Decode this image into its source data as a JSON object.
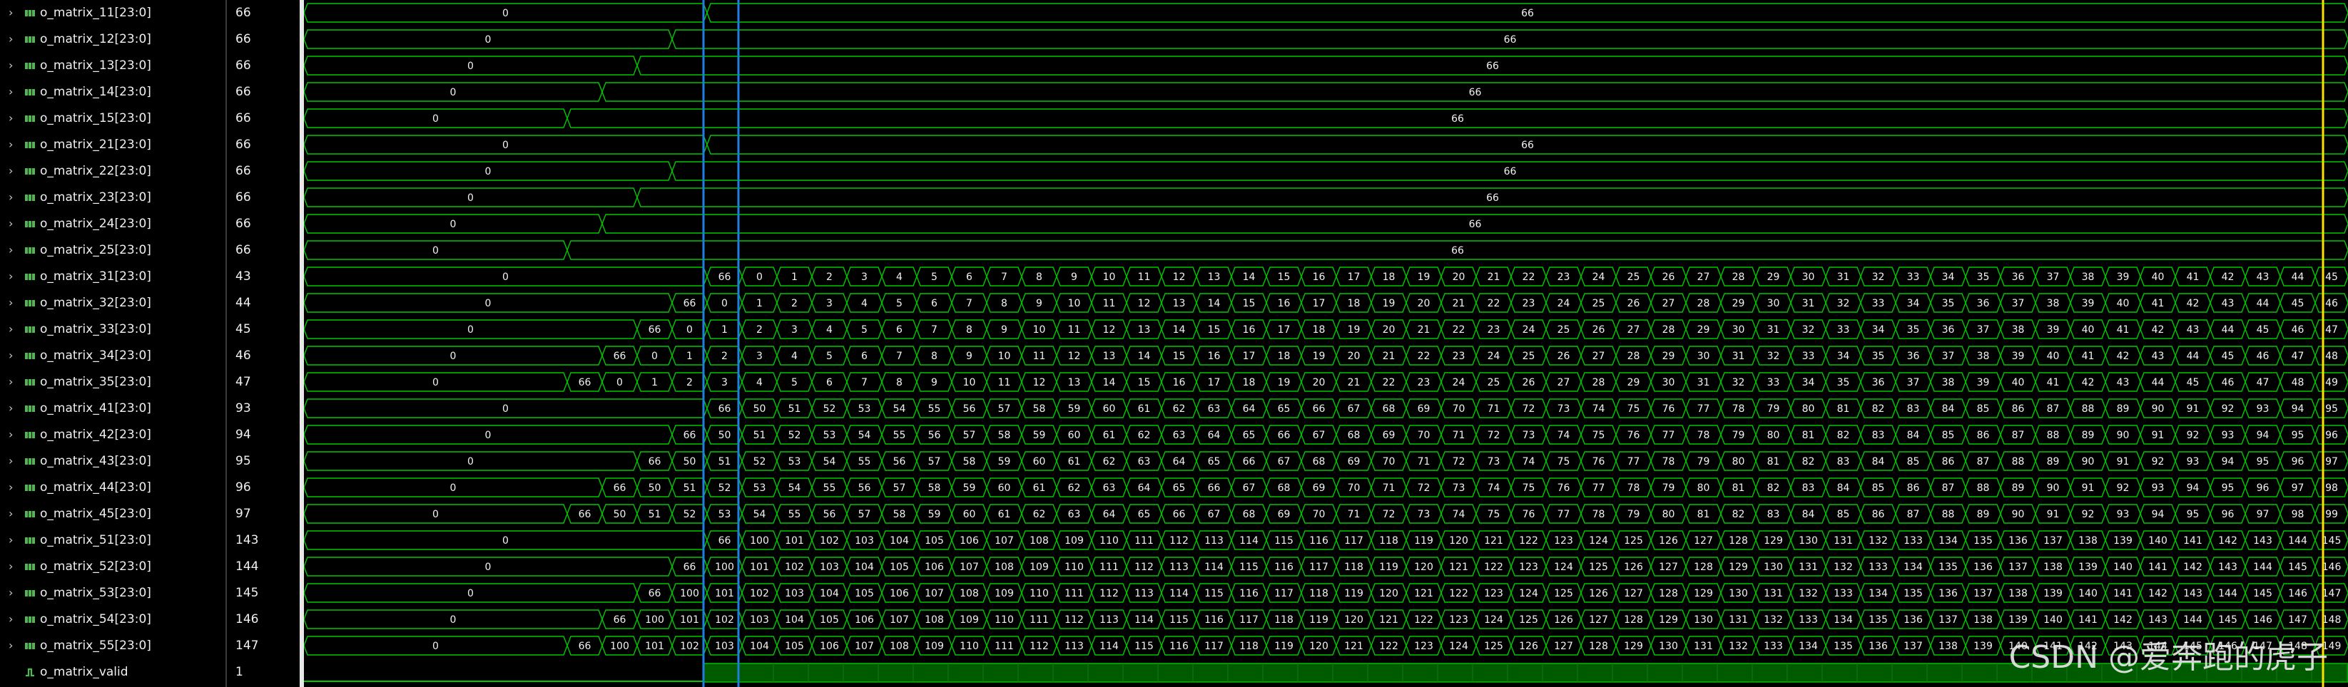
{
  "signals": [
    {
      "name": "o_matrix_11[23:0]",
      "value": "66"
    },
    {
      "name": "o_matrix_12[23:0]",
      "value": "66"
    },
    {
      "name": "o_matrix_13[23:0]",
      "value": "66"
    },
    {
      "name": "o_matrix_14[23:0]",
      "value": "66"
    },
    {
      "name": "o_matrix_15[23:0]",
      "value": "66"
    },
    {
      "name": "o_matrix_21[23:0]",
      "value": "66"
    },
    {
      "name": "o_matrix_22[23:0]",
      "value": "66"
    },
    {
      "name": "o_matrix_23[23:0]",
      "value": "66"
    },
    {
      "name": "o_matrix_24[23:0]",
      "value": "66"
    },
    {
      "name": "o_matrix_25[23:0]",
      "value": "66"
    },
    {
      "name": "o_matrix_31[23:0]",
      "value": "43"
    },
    {
      "name": "o_matrix_32[23:0]",
      "value": "44"
    },
    {
      "name": "o_matrix_33[23:0]",
      "value": "45"
    },
    {
      "name": "o_matrix_34[23:0]",
      "value": "46"
    },
    {
      "name": "o_matrix_35[23:0]",
      "value": "47"
    },
    {
      "name": "o_matrix_41[23:0]",
      "value": "93"
    },
    {
      "name": "o_matrix_42[23:0]",
      "value": "94"
    },
    {
      "name": "o_matrix_43[23:0]",
      "value": "95"
    },
    {
      "name": "o_matrix_44[23:0]",
      "value": "96"
    },
    {
      "name": "o_matrix_45[23:0]",
      "value": "97"
    },
    {
      "name": "o_matrix_51[23:0]",
      "value": "143"
    },
    {
      "name": "o_matrix_52[23:0]",
      "value": "144"
    },
    {
      "name": "o_matrix_53[23:0]",
      "value": "145"
    },
    {
      "name": "o_matrix_54[23:0]",
      "value": "146"
    },
    {
      "name": "o_matrix_55[23:0]",
      "value": "147"
    },
    {
      "name": "o_matrix_valid",
      "value": "1"
    }
  ],
  "waveform": {
    "initial_value": "0",
    "settled_value": "66",
    "counter_rows": {
      "row3": {
        "first": 0
      },
      "row4": {
        "first": 50
      },
      "row5": {
        "first": 100
      }
    },
    "valid_level": "1"
  },
  "colors": {
    "bus": "#00c800",
    "valid_fill": "#005a00",
    "cursor_blue": "#1e7fe0",
    "cursor_yellow": "#ffe000"
  },
  "watermark": "CSDN @爱奔跑的虎子"
}
